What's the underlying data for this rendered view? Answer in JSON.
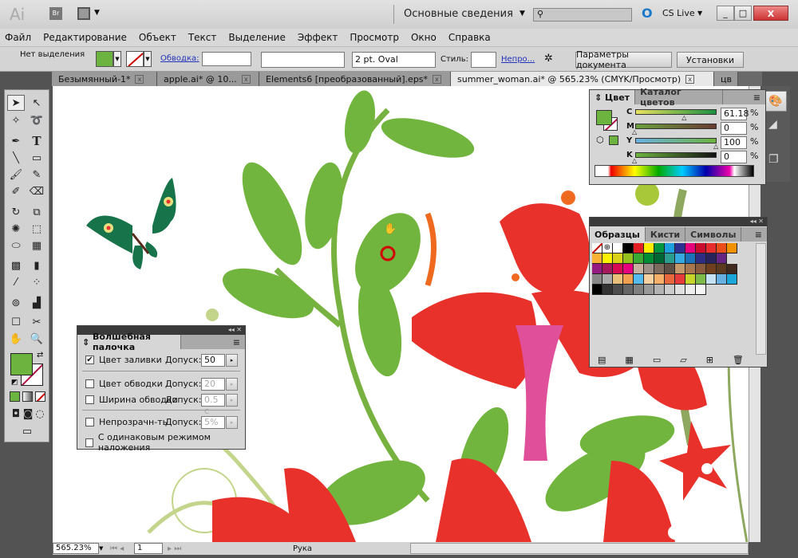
{
  "app": {
    "logo": "Ai",
    "bridge": "Br",
    "workspace": "Основные сведения",
    "search_placeholder": "",
    "cs_live": "CS Live"
  },
  "menu": [
    "Файл",
    "Редактирование",
    "Объект",
    "Текст",
    "Выделение",
    "Эффект",
    "Просмотр",
    "Окно",
    "Справка"
  ],
  "control": {
    "selection": "Нет выделения",
    "stroke_label": "Обводка:",
    "brush": "2 pt. Oval",
    "style_label": "Стиль:",
    "opacity_label": "Непро...",
    "doc_settings": "Параметры документа",
    "preferences": "Установки"
  },
  "tabs": [
    {
      "label": "Безымянный-1*"
    },
    {
      "label": "apple.ai* @ 10..."
    },
    {
      "label": "Elements6 [преобразованный].eps*"
    },
    {
      "label": "summer_woman.ai* @ 565.23% (CMYK/Просмотр)"
    },
    {
      "label": "цв"
    }
  ],
  "colors": {
    "fill": "#6db33f",
    "accent": "#d40000"
  },
  "color_panel": {
    "tab_color": "Цвет",
    "tab_guide": "Каталог цветов",
    "channels": [
      {
        "name": "C",
        "value": "61.18",
        "frac": 0.61
      },
      {
        "name": "M",
        "value": "0",
        "frac": 0
      },
      {
        "name": "Y",
        "value": "100",
        "frac": 1
      },
      {
        "name": "K",
        "value": "0",
        "frac": 0
      }
    ],
    "unit": "%"
  },
  "swatches_panel": {
    "tabs": [
      "Образцы",
      "Кисти",
      "Символы"
    ],
    "rows": [
      [
        "#ffffff",
        "#ffffff",
        "#ffffff",
        "#000000",
        "#e31e24",
        "#ffed00",
        "#009640",
        "#1d9fe0",
        "#2e3192",
        "#e5007e",
        "#c8102e",
        "#e52e2d",
        "#e94e1b",
        "#f39200"
      ],
      [
        "#f9b233",
        "#fff200",
        "#d9d216",
        "#95c11f",
        "#3aaa35",
        "#008d36",
        "#006633",
        "#2a9d8f",
        "#36a9e1",
        "#1d71b8",
        "#2d2e83",
        "#29235c",
        "#662483"
      ],
      [
        "#951b81",
        "#a3195b",
        "#d60b52",
        "#e6007e",
        "#c6b0a0",
        "#9d9087",
        "#7b6a5d",
        "#5e4e43",
        "#c49a6c",
        "#a9774d",
        "#8a5a3c",
        "#6f4020",
        "#5b3a1f",
        "#3e2a1e"
      ],
      [
        "#888888",
        "#aaaaaa",
        "#e8c07a",
        "#f0a050",
        "#55bbee",
        "#f5d0a0",
        "#f7b06a",
        "#e7683d",
        "#e53b3b",
        "#c7d42a",
        "#7dba4a",
        "#c5e2f4",
        "#67b1e2",
        "#1aa6d8"
      ],
      [
        "#000000",
        "#333333",
        "#4d4d4d",
        "#666666",
        "#808080",
        "#999999",
        "#b3b3b3",
        "#cccccc",
        "#e0e0e0",
        "#eeeeee",
        "#f6f6f6"
      ]
    ]
  },
  "magic_wand": {
    "title": "Волшебная палочка",
    "tolerance": "Допуск:",
    "rows": [
      {
        "label": "Цвет заливки",
        "value": "50",
        "checked": true
      },
      {
        "label": "Цвет обводки",
        "value": "20"
      },
      {
        "label": "Ширина обводки",
        "value": "0.5 с"
      },
      {
        "label": "Непрозрачн-ть",
        "value": "5%"
      }
    ],
    "blend": "С одинаковым режимом наложения"
  },
  "status": {
    "zoom": "565.23%",
    "page": "1",
    "tool": "Рука"
  }
}
